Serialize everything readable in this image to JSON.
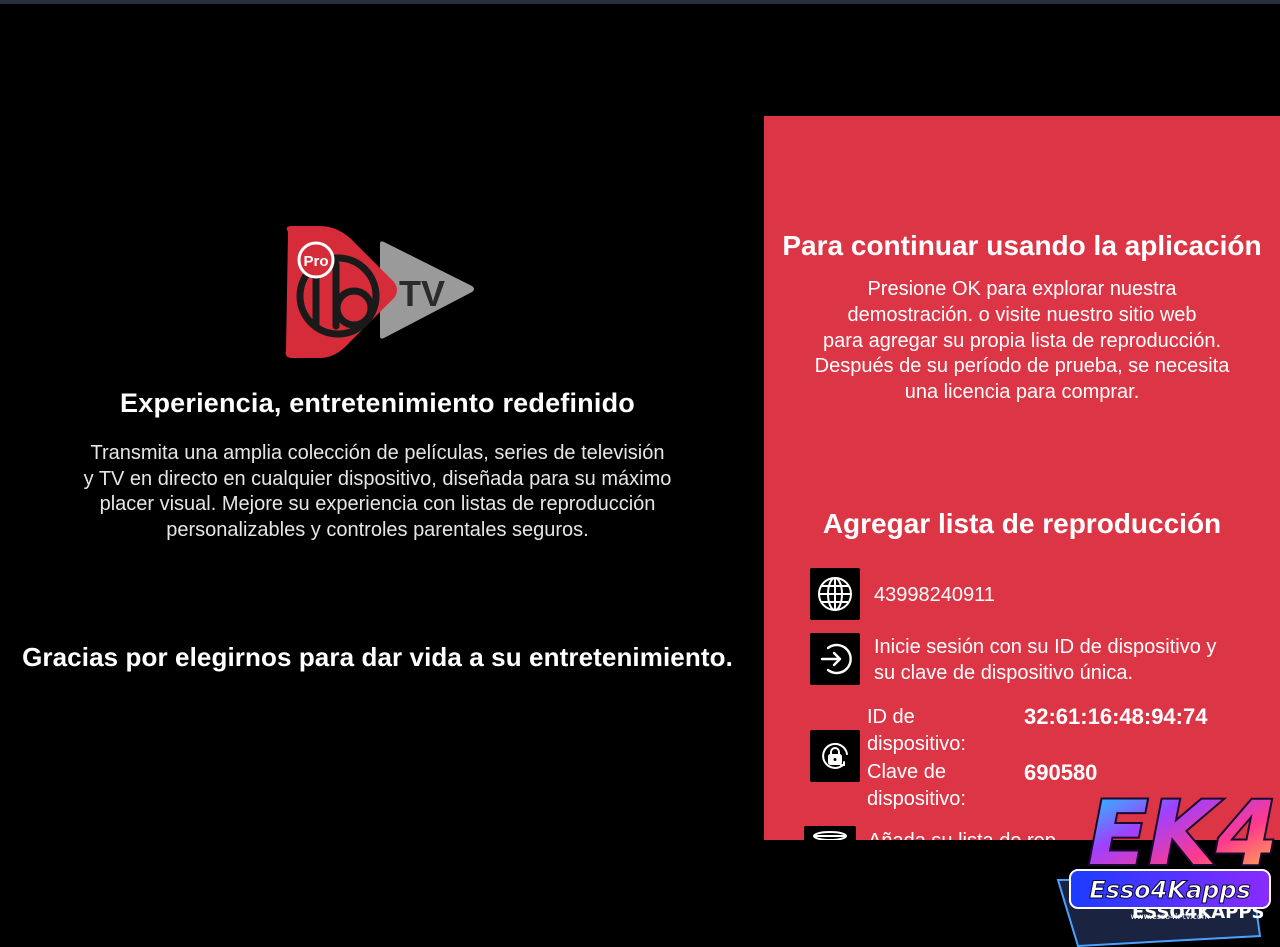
{
  "logo": {
    "badge": "Pro",
    "mark": "ib",
    "tv": "TV"
  },
  "left": {
    "tagline": "Experiencia, entretenimiento redefinido",
    "description_lines": [
      "Transmita una amplia colección de películas, series de televisión",
      "y TV en directo en cualquier dispositivo, diseñada para su máximo",
      "placer visual. Mejore su experiencia con listas de reproducción",
      "personalizables y controles parentales seguros."
    ],
    "thanks": "Gracias por elegirnos para dar vida a su entretenimiento."
  },
  "panel": {
    "title": "Para continuar usando la aplicación",
    "text_lines": [
      "Presione OK para explorar nuestra",
      "demostración. o visite nuestro sitio web",
      "para agregar su propia lista de reproducción.",
      "Después de su período de prueba, se necesita",
      "una licencia para comprar."
    ],
    "section_title": "Agregar lista de reproducción",
    "items": [
      {
        "icon": "globe-icon",
        "text": "43998240911"
      },
      {
        "icon": "login-icon",
        "text_lines": [
          "Inicie sesión con su ID de dispositivo y",
          "su clave de dispositivo única."
        ]
      }
    ],
    "device_id_label_lines": [
      "ID de",
      "dispositivo:"
    ],
    "device_id_value": "32:61:16:48:94:74",
    "device_key_label_lines": [
      "Clave de",
      "dispositivo:"
    ],
    "device_key_value": "690580",
    "lock_icon": "lock-refresh-icon",
    "partial_item_text": "Añada su lista de rep",
    "partial_item_icon": "playlist-icon"
  },
  "watermark": {
    "brand": "EK4",
    "name": "Esso4Kapps",
    "url": "www.esso4k-tv.com",
    "shadow_text": "ESSO4KAPPS"
  },
  "colors": {
    "panel_bg": "#dc3545",
    "logo_red": "#d62b39",
    "logo_gray": "#9a9a9a"
  }
}
